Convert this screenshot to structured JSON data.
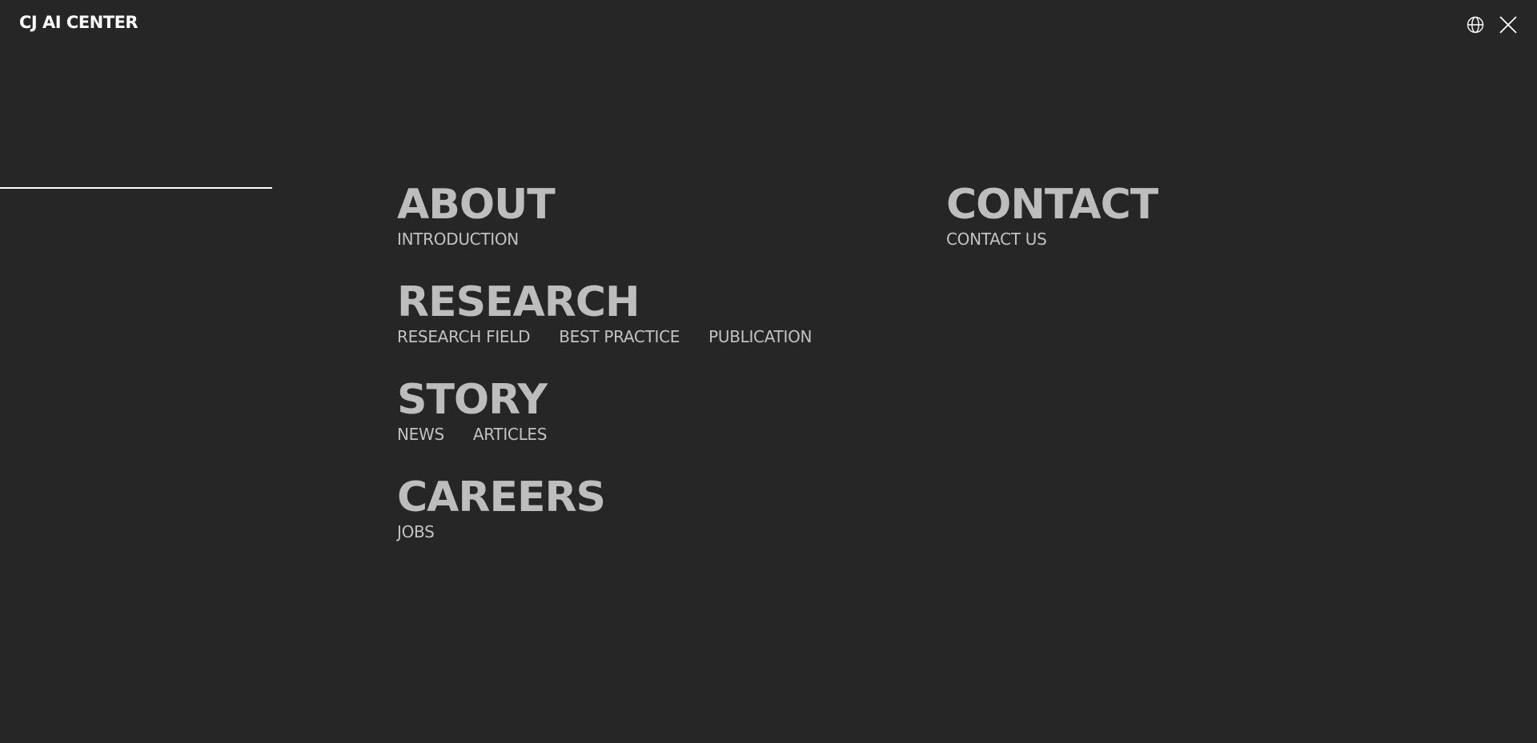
{
  "header": {
    "logo_text": "CJ AI CENTER",
    "language_icon": "globe-icon",
    "close_icon": "close-icon"
  },
  "colors": {
    "background": "#262626",
    "title": "#bdbdbd",
    "submenu": "#c2c2c2",
    "accent_line": "#ffffff"
  },
  "menu": {
    "about": {
      "title": "ABOUT",
      "items": [
        "INTRODUCTION"
      ]
    },
    "research": {
      "title": "RESEARCH",
      "items": [
        "RESEARCH FIELD",
        "BEST PRACTICE",
        "PUBLICATION"
      ]
    },
    "story": {
      "title": "STORY",
      "items": [
        "NEWS",
        "ARTICLES"
      ]
    },
    "careers": {
      "title": "CAREERS",
      "items": [
        "JOBS"
      ]
    },
    "contact": {
      "title": "CONTACT",
      "items": [
        "CONTACT US"
      ]
    }
  }
}
